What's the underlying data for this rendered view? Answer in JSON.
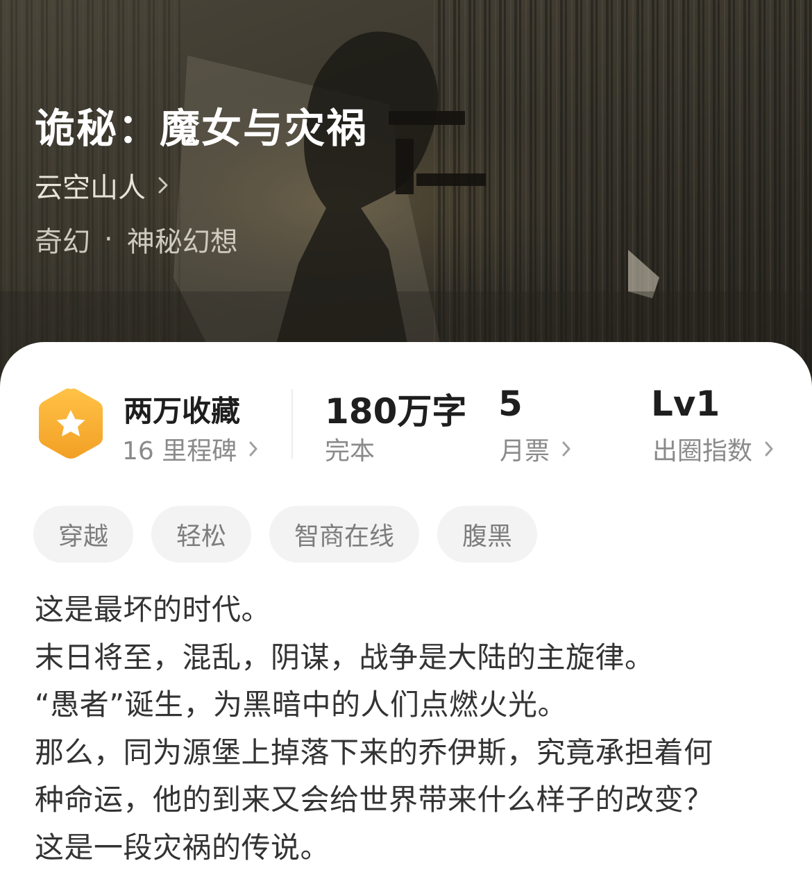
{
  "book": {
    "title": "诡秘：魔女与灾祸",
    "author": "云空山人",
    "category": "奇幻",
    "genre_separator": "·",
    "subgenre": "神秘幻想"
  },
  "stats": {
    "collect": {
      "label": "两万收藏",
      "sub": "16 里程碑",
      "icon": "star-badge-icon"
    },
    "words": {
      "value": "180万字",
      "sub": "完本"
    },
    "monthly_tickets": {
      "value": "5",
      "sub": "月票"
    },
    "popularity": {
      "value": "Lv1",
      "sub": "出圈指数"
    }
  },
  "tags": [
    "穿越",
    "轻松",
    "智商在线",
    "腹黑"
  ],
  "synopsis": [
    "这是最坏的时代。",
    "末日将至，混乱，阴谋，战争是大陆的主旋律。",
    "“愚者”诞生，为黑暗中的人们点燃火光。",
    "那么，同为源堡上掉落下来的乔伊斯，究竟承担着何",
    "种命运，他的到来又会给世界带来什么样子的改变？",
    "这是一段灾祸的传说。"
  ],
  "colors": {
    "badge_orange": "#f5a623",
    "hero_dark": "#3c382e",
    "text_primary": "#1e1e1e",
    "text_secondary": "#8a8a8a",
    "tag_bg": "#f3f3f3"
  }
}
